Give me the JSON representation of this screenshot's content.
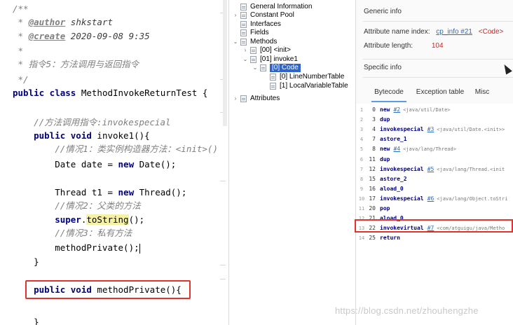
{
  "editor": {
    "lines": [
      {
        "parts": [
          [
            "cm",
            "/**"
          ]
        ]
      },
      {
        "parts": [
          [
            "cm",
            " * "
          ],
          [
            "dtag",
            "@author"
          ],
          [
            "dval",
            " shkstart"
          ]
        ]
      },
      {
        "parts": [
          [
            "cm",
            " * "
          ],
          [
            "dtag",
            "@create"
          ],
          [
            "dval",
            " 2020-09-08 9:35"
          ]
        ]
      },
      {
        "parts": [
          [
            "cm",
            " *"
          ]
        ]
      },
      {
        "parts": [
          [
            "cm",
            " * 指令5：方法调用与返回指令"
          ]
        ]
      },
      {
        "parts": [
          [
            "cm",
            " */"
          ]
        ]
      },
      {
        "parts": [
          [
            "kw",
            "public class "
          ],
          [
            "ty",
            "MethodInvokeReturnTest {"
          ]
        ]
      },
      {
        "parts": [
          [
            "ty",
            ""
          ]
        ]
      },
      {
        "parts": [
          [
            "cmt",
            "    //方法调用指令:invokespecial"
          ]
        ]
      },
      {
        "parts": [
          [
            "kw",
            "    public void "
          ],
          [
            "fn",
            "invoke1(){"
          ]
        ]
      },
      {
        "parts": [
          [
            "cmt",
            "        //情况1：类实例构造器方法：<init>()"
          ]
        ]
      },
      {
        "parts": [
          [
            "ty",
            "        Date date = "
          ],
          [
            "kw",
            "new "
          ],
          [
            "ty",
            "Date();"
          ]
        ]
      },
      {
        "parts": [
          [
            "ty",
            ""
          ]
        ]
      },
      {
        "parts": [
          [
            "ty",
            "        Thread t1 = "
          ],
          [
            "kw",
            "new "
          ],
          [
            "ty",
            "Thread();"
          ]
        ]
      },
      {
        "parts": [
          [
            "cmt",
            "        //情况2：父类的方法"
          ]
        ]
      },
      {
        "parts": [
          [
            "kw",
            "        super"
          ],
          [
            "ty",
            "."
          ],
          [
            "hl",
            "toString"
          ],
          [
            "ty",
            "();"
          ]
        ]
      },
      {
        "parts": [
          [
            "cmt",
            "        //情况3：私有方法"
          ]
        ]
      },
      {
        "parts": [
          [
            "ty",
            "        methodPrivate();"
          ],
          [
            "caret",
            ""
          ]
        ]
      },
      {
        "parts": [
          [
            "ty",
            "    }"
          ]
        ]
      },
      {
        "parts": [
          [
            "ty",
            ""
          ]
        ]
      },
      {
        "parts": [
          [
            "kw",
            "    public void "
          ],
          [
            "ty",
            "methodPrivate(){"
          ]
        ]
      },
      {
        "parts": [
          [
            "ty",
            ""
          ]
        ]
      },
      {
        "parts": [
          [
            "ty",
            "    }"
          ]
        ]
      }
    ]
  },
  "tree": [
    {
      "label": "General Information",
      "indent": 0,
      "arrow": "",
      "selected": false
    },
    {
      "label": "Constant Pool",
      "indent": 0,
      "arrow": "›",
      "selected": false
    },
    {
      "label": "Interfaces",
      "indent": 0,
      "arrow": "",
      "selected": false
    },
    {
      "label": "Fields",
      "indent": 0,
      "arrow": "",
      "selected": false
    },
    {
      "label": "Methods",
      "indent": 0,
      "arrow": "⌄",
      "selected": false
    },
    {
      "label": "[00] <init>",
      "indent": 1,
      "arrow": "›",
      "selected": false
    },
    {
      "label": "[01] invoke1",
      "indent": 1,
      "arrow": "⌄",
      "selected": false
    },
    {
      "label": "[0] Code",
      "indent": 2,
      "arrow": "⌄",
      "selected": true
    },
    {
      "label": "[0] LineNumberTable",
      "indent": 3,
      "arrow": "",
      "selected": false
    },
    {
      "label": "[1] LocalVariableTable",
      "indent": 3,
      "arrow": "",
      "selected": false
    },
    {
      "label": "Attributes",
      "indent": 0,
      "arrow": "›",
      "selected": false,
      "gap": true
    }
  ],
  "info": {
    "generic_title": "Generic info",
    "attr_name_label": "Attribute name index:",
    "attr_name_link": "cp_info #21",
    "attr_name_value": "<Code>",
    "attr_length_label": "Attribute length:",
    "attr_length_value": "104",
    "specific_title": "Specific info",
    "tabs": [
      "Bytecode",
      "Exception table",
      "Misc"
    ],
    "active_tab": "Bytecode"
  },
  "bytecode": [
    {
      "n": "1",
      "off": "0",
      "op": "new",
      "ref": "#2",
      "cm": "<java/util/Date>"
    },
    {
      "n": "2",
      "off": "3",
      "op": "dup",
      "ref": "",
      "cm": ""
    },
    {
      "n": "3",
      "off": "4",
      "op": "invokespecial",
      "ref": "#3",
      "cm": "<java/util/Date.<init>>"
    },
    {
      "n": "4",
      "off": "7",
      "op": "astore_1",
      "ref": "",
      "cm": ""
    },
    {
      "n": "5",
      "off": "8",
      "op": "new",
      "ref": "#4",
      "cm": "<java/lang/Thread>"
    },
    {
      "n": "6",
      "off": "11",
      "op": "dup",
      "ref": "",
      "cm": ""
    },
    {
      "n": "7",
      "off": "12",
      "op": "invokespecial",
      "ref": "#5",
      "cm": "<java/lang/Thread.<init"
    },
    {
      "n": "8",
      "off": "15",
      "op": "astore_2",
      "ref": "",
      "cm": ""
    },
    {
      "n": "9",
      "off": "16",
      "op": "aload_0",
      "ref": "",
      "cm": ""
    },
    {
      "n": "10",
      "off": "17",
      "op": "invokespecial",
      "ref": "#6",
      "cm": "<java/lang/Object.toStri"
    },
    {
      "n": "11",
      "off": "20",
      "op": "pop",
      "ref": "",
      "cm": ""
    },
    {
      "n": "12",
      "off": "21",
      "op": "aload_0",
      "ref": "",
      "cm": ""
    },
    {
      "n": "13",
      "off": "22",
      "op": "invokevirtual",
      "ref": "#7",
      "cm": "<com/atguigu/java/Metho"
    },
    {
      "n": "14",
      "off": "25",
      "op": "return",
      "ref": "",
      "cm": ""
    }
  ],
  "watermark": "https://blog.csdn.net/zhouhengzhe"
}
